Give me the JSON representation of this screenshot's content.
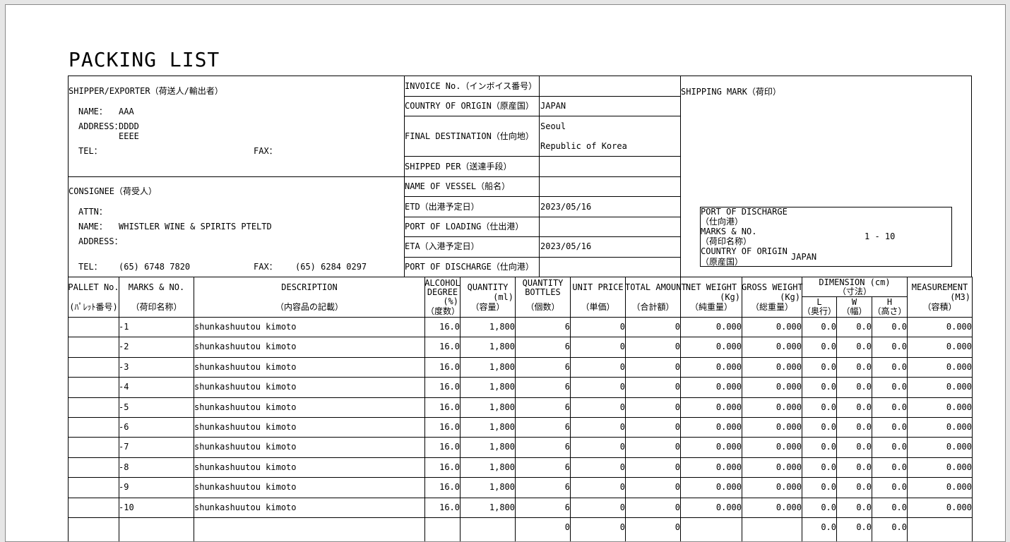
{
  "title": "PACKING LIST",
  "shipper": {
    "heading": "SHIPPER/EXPORTER（荷送人/輸出者）",
    "name_label": "NAME：",
    "name": "AAA",
    "address_label": "ADDRESS：",
    "address_line1": "DDDD",
    "address_line2": "EEEE",
    "tel_label": "TEL：",
    "fax_label": "FAX："
  },
  "consignee": {
    "heading": "CONSIGNEE（荷受人）",
    "attn_label": "ATTN：",
    "name_label": "NAME：",
    "name": "WHISTLER WINE & SPIRITS PTELTD",
    "address_label": "ADDRESS：",
    "tel_label": "TEL：",
    "tel": "(65) 6748 7820",
    "fax_label": "FAX：",
    "fax": "(65) 6284 0297"
  },
  "info": [
    {
      "label": "INVOICE No.（インボイス番号）",
      "value": ""
    },
    {
      "label": "COUNTRY OF ORIGIN（原産国）",
      "value": "JAPAN"
    },
    {
      "label": "FINAL DESTINATION（仕向地）",
      "value": "Seoul",
      "value2": "Republic of Korea"
    },
    {
      "label": "SHIPPED PER（送達手段）",
      "value": ""
    },
    {
      "label": "NAME OF VESSEL（船名）",
      "value": ""
    },
    {
      "label": "ETD（出港予定日）",
      "value": "2023/05/16"
    },
    {
      "label": "PORT OF LOADING（仕出港）",
      "value": ""
    },
    {
      "label": "ETA（入港予定日）",
      "value": "2023/05/16"
    },
    {
      "label": "PORT OF DISCHARGE（仕向港）",
      "value": ""
    }
  ],
  "shipping_mark": {
    "heading": "SHIPPING MARK（荷印）",
    "pod_label": "PORT OF DISCHARGE",
    "pod_sub": "（仕向港）",
    "marks_label": "MARKS & NO.",
    "marks_sub": "（荷印名称）",
    "marks_value": "1 - 10",
    "coo_label": "COUNTRY OF ORIGIN",
    "coo_sub": "（原産国）",
    "coo_value": "JAPAN"
  },
  "columns": {
    "pallet": "PALLET No.",
    "pallet_sub": "(ﾊﾟﾚｯﾄ番号)",
    "marks": "MARKS & NO.",
    "marks_sub": "（荷印名称）",
    "description": "DESCRIPTION",
    "description_sub": "（内容品の記載）",
    "alcohol_1": "ALCOHOL",
    "alcohol_2": "DEGREE",
    "alcohol_unit": "(%)",
    "alcohol_sub": "（度数）",
    "quantity": "QUANTITY",
    "quantity_unit": "(ml)",
    "quantity_sub": "（容量）",
    "bottles_1": "QUANTITY",
    "bottles_2": "BOTTLES",
    "bottles_sub": "（個数）",
    "unit_price": "UNIT PRICE",
    "unit_price_sub": "（単価）",
    "total_amount": "TOTAL AMOUNT",
    "total_amount_sub": "（合計額）",
    "net_weight": "NET WEIGHT",
    "net_weight_unit": "(Kg)",
    "net_weight_sub": "（純重量）",
    "gross_weight": "GROSS WEIGHT",
    "gross_weight_unit": "(Kg)",
    "gross_weight_sub": "（総重量）",
    "dimension": "DIMENSION (cm)",
    "dimension_sub": "（寸法）",
    "dim_l": "L",
    "dim_l_sub": "（奥行）",
    "dim_w": "W",
    "dim_w_sub": "（幅）",
    "dim_h": "H",
    "dim_h_sub": "（高さ）",
    "measurement": "MEASUREMENT",
    "measurement_unit": "(M3)",
    "measurement_sub": "（容積）"
  },
  "rows": [
    {
      "pallet": "",
      "marks": "-1",
      "description": "shunkashuutou kimoto",
      "alcohol": "16.0",
      "quantity": "1,800",
      "bottles": "6",
      "unit_price": "0",
      "total_amount": "0",
      "net_weight": "0.000",
      "gross_weight": "0.000",
      "l": "0.0",
      "w": "0.0",
      "h": "0.0",
      "measurement": "0.000"
    },
    {
      "pallet": "",
      "marks": "-2",
      "description": "shunkashuutou kimoto",
      "alcohol": "16.0",
      "quantity": "1,800",
      "bottles": "6",
      "unit_price": "0",
      "total_amount": "0",
      "net_weight": "0.000",
      "gross_weight": "0.000",
      "l": "0.0",
      "w": "0.0",
      "h": "0.0",
      "measurement": "0.000"
    },
    {
      "pallet": "",
      "marks": "-3",
      "description": "shunkashuutou kimoto",
      "alcohol": "16.0",
      "quantity": "1,800",
      "bottles": "6",
      "unit_price": "0",
      "total_amount": "0",
      "net_weight": "0.000",
      "gross_weight": "0.000",
      "l": "0.0",
      "w": "0.0",
      "h": "0.0",
      "measurement": "0.000"
    },
    {
      "pallet": "",
      "marks": "-4",
      "description": "shunkashuutou kimoto",
      "alcohol": "16.0",
      "quantity": "1,800",
      "bottles": "6",
      "unit_price": "0",
      "total_amount": "0",
      "net_weight": "0.000",
      "gross_weight": "0.000",
      "l": "0.0",
      "w": "0.0",
      "h": "0.0",
      "measurement": "0.000"
    },
    {
      "pallet": "",
      "marks": "-5",
      "description": "shunkashuutou kimoto",
      "alcohol": "16.0",
      "quantity": "1,800",
      "bottles": "6",
      "unit_price": "0",
      "total_amount": "0",
      "net_weight": "0.000",
      "gross_weight": "0.000",
      "l": "0.0",
      "w": "0.0",
      "h": "0.0",
      "measurement": "0.000"
    },
    {
      "pallet": "",
      "marks": "-6",
      "description": "shunkashuutou kimoto",
      "alcohol": "16.0",
      "quantity": "1,800",
      "bottles": "6",
      "unit_price": "0",
      "total_amount": "0",
      "net_weight": "0.000",
      "gross_weight": "0.000",
      "l": "0.0",
      "w": "0.0",
      "h": "0.0",
      "measurement": "0.000"
    },
    {
      "pallet": "",
      "marks": "-7",
      "description": "shunkashuutou kimoto",
      "alcohol": "16.0",
      "quantity": "1,800",
      "bottles": "6",
      "unit_price": "0",
      "total_amount": "0",
      "net_weight": "0.000",
      "gross_weight": "0.000",
      "l": "0.0",
      "w": "0.0",
      "h": "0.0",
      "measurement": "0.000"
    },
    {
      "pallet": "",
      "marks": "-8",
      "description": "shunkashuutou kimoto",
      "alcohol": "16.0",
      "quantity": "1,800",
      "bottles": "6",
      "unit_price": "0",
      "total_amount": "0",
      "net_weight": "0.000",
      "gross_weight": "0.000",
      "l": "0.0",
      "w": "0.0",
      "h": "0.0",
      "measurement": "0.000"
    },
    {
      "pallet": "",
      "marks": "-9",
      "description": "shunkashuutou kimoto",
      "alcohol": "16.0",
      "quantity": "1,800",
      "bottles": "6",
      "unit_price": "0",
      "total_amount": "0",
      "net_weight": "0.000",
      "gross_weight": "0.000",
      "l": "0.0",
      "w": "0.0",
      "h": "0.0",
      "measurement": "0.000"
    },
    {
      "pallet": "",
      "marks": "-10",
      "description": "shunkashuutou kimoto",
      "alcohol": "16.0",
      "quantity": "1,800",
      "bottles": "6",
      "unit_price": "0",
      "total_amount": "0",
      "net_weight": "0.000",
      "gross_weight": "0.000",
      "l": "0.0",
      "w": "0.0",
      "h": "0.0",
      "measurement": "0.000"
    },
    {
      "pallet": "",
      "marks": "",
      "description": "",
      "alcohol": "",
      "quantity": "",
      "bottles": "0",
      "unit_price": "0",
      "total_amount": "0",
      "net_weight": "",
      "gross_weight": "",
      "l": "0.0",
      "w": "0.0",
      "h": "0.0",
      "measurement": ""
    }
  ]
}
